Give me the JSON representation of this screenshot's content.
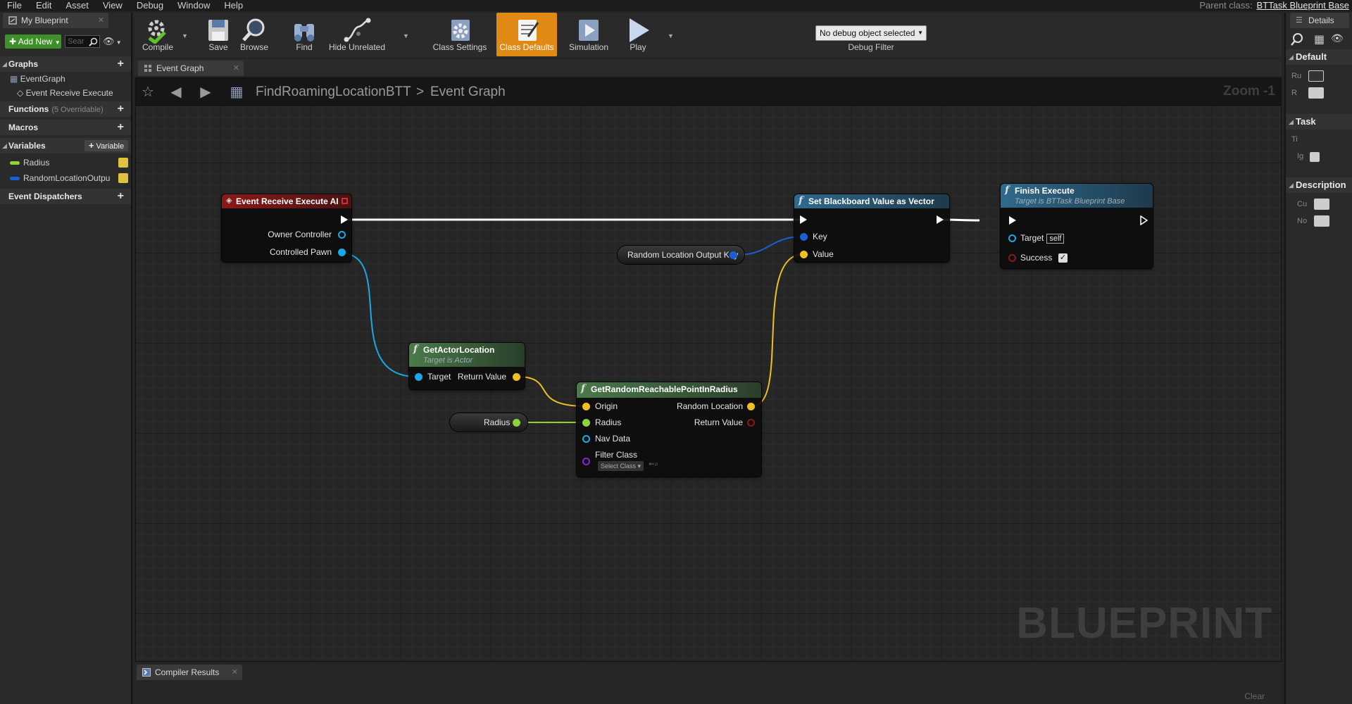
{
  "menu": [
    "File",
    "Edit",
    "Asset",
    "View",
    "Debug",
    "Window",
    "Help"
  ],
  "parent_class": {
    "label": "Parent class:",
    "value": "BTTask Blueprint Base"
  },
  "my_blueprint": {
    "tab_title": "My Blueprint",
    "add_new": "Add New",
    "search_placeholder": "Sear",
    "graphs": "Graphs",
    "event_graph": "EventGraph",
    "event_item": "Event Receive Execute",
    "functions": "Functions",
    "functions_sub": "(5 Overridable)",
    "macros": "Macros",
    "variables": "Variables",
    "add_variable": "Variable",
    "vars": [
      {
        "name": "Radius",
        "color": "#8cd43c"
      },
      {
        "name": "RandomLocationOutpu",
        "color": "#1a5fd6"
      }
    ],
    "event_dispatchers": "Event Dispatchers"
  },
  "toolbar": {
    "compile": "Compile",
    "save": "Save",
    "browse": "Browse",
    "find": "Find",
    "hide_unrelated": "Hide Unrelated",
    "class_settings": "Class Settings",
    "class_defaults": "Class Defaults",
    "simulation": "Simulation",
    "play": "Play",
    "debug_select": "No debug object selected",
    "debug_filter": "Debug Filter"
  },
  "graph_tab": "Event Graph",
  "breadcrumb": {
    "blueprint": "FindRoamingLocationBTT",
    "separator": ">",
    "graph": "Event Graph"
  },
  "zoom": "Zoom -1",
  "watermark": "BLUEPRINT",
  "nodes": {
    "event": {
      "title": "Event Receive Execute AI",
      "owner": "Owner Controller",
      "pawn": "Controlled Pawn"
    },
    "set_bb": {
      "title": "Set Blackboard Value as Vector",
      "key": "Key",
      "value": "Value"
    },
    "finish": {
      "title": "Finish Execute",
      "subtitle": "Target is BTTask Blueprint Base",
      "target": "Target",
      "self": "self",
      "success": "Success"
    },
    "bb_key_var": "Random Location Output Key",
    "get_loc": {
      "title": "GetActorLocation",
      "subtitle": "Target is Actor",
      "target": "Target",
      "return": "Return Value"
    },
    "random_point": {
      "title": "GetRandomReachablePointInRadius",
      "origin": "Origin",
      "radius": "Radius",
      "nav": "Nav Data",
      "filter": "Filter Class",
      "select_class": "Select Class",
      "random_loc": "Random Location",
      "return": "Return Value"
    },
    "radius_var": "Radius"
  },
  "compiler_results": "Compiler Results",
  "clear": "Clear",
  "details": {
    "title": "Details",
    "default": "Default",
    "task": "Task",
    "description": "Description",
    "rows": [
      "Ru",
      "R",
      "Ti",
      "Ig",
      "Cu",
      "No"
    ]
  },
  "colors": {
    "exec": "#ffffff",
    "object": "#1aa9e8",
    "vector": "#f0c020",
    "float": "#8cd43c",
    "struct": "#1a5fd6",
    "accent": "#e08a15",
    "event_header": "#8a1a1a",
    "function_header": "#2a5a78",
    "pure_header": "#3c6a3c"
  }
}
